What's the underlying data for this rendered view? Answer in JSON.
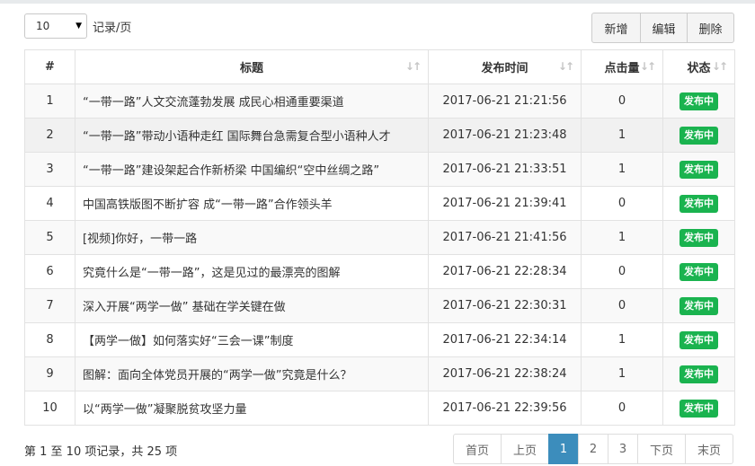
{
  "toolbar": {
    "page_size": "10",
    "page_size_unit": "记录/页",
    "add_label": "新增",
    "edit_label": "编辑",
    "delete_label": "删除"
  },
  "table": {
    "headers": [
      "#",
      "标题",
      "发布时间",
      "点击量",
      "状态"
    ],
    "rows": [
      {
        "idx": "1",
        "title": "“一带一路”人文交流蓬勃发展 成民心相通重要渠道",
        "time": "2017-06-21 21:21:56",
        "clicks": "0",
        "status": "发布中"
      },
      {
        "idx": "2",
        "title": "“一带一路”带动小语种走红 国际舞台急需复合型小语种人才",
        "time": "2017-06-21 21:23:48",
        "clicks": "1",
        "status": "发布中"
      },
      {
        "idx": "3",
        "title": "“一带一路”建设架起合作新桥梁 中国编织“空中丝绸之路”",
        "time": "2017-06-21 21:33:51",
        "clicks": "1",
        "status": "发布中"
      },
      {
        "idx": "4",
        "title": "中国高铁版图不断扩容 成“一带一路”合作领头羊",
        "time": "2017-06-21 21:39:41",
        "clicks": "0",
        "status": "发布中"
      },
      {
        "idx": "5",
        "title": "[视频]你好，一带一路",
        "time": "2017-06-21 21:41:56",
        "clicks": "1",
        "status": "发布中"
      },
      {
        "idx": "6",
        "title": "究竟什么是“一带一路”，这是见过的最漂亮的图解",
        "time": "2017-06-21 22:28:34",
        "clicks": "0",
        "status": "发布中"
      },
      {
        "idx": "7",
        "title": "深入开展“两学一做” 基础在学关键在做",
        "time": "2017-06-21 22:30:31",
        "clicks": "0",
        "status": "发布中"
      },
      {
        "idx": "8",
        "title": "【两学一做】如何落实好“三会一课”制度",
        "time": "2017-06-21 22:34:14",
        "clicks": "1",
        "status": "发布中"
      },
      {
        "idx": "9",
        "title": "图解：面向全体党员开展的“两学一做”究竟是什么？",
        "time": "2017-06-21 22:38:24",
        "clicks": "1",
        "status": "发布中"
      },
      {
        "idx": "10",
        "title": "以“两学一做”凝聚脱贫攻坚力量",
        "time": "2017-06-21 22:39:56",
        "clicks": "0",
        "status": "发布中"
      }
    ]
  },
  "footer": {
    "info": "第 1 至 10 项记录，共 25 项"
  },
  "pagination": {
    "first": "首页",
    "prev": "上页",
    "pages": [
      "1",
      "2",
      "3"
    ],
    "next": "下页",
    "last": "末页"
  },
  "colors": {
    "badge": "#1ab34f",
    "active_page": "#3c8dbc"
  }
}
